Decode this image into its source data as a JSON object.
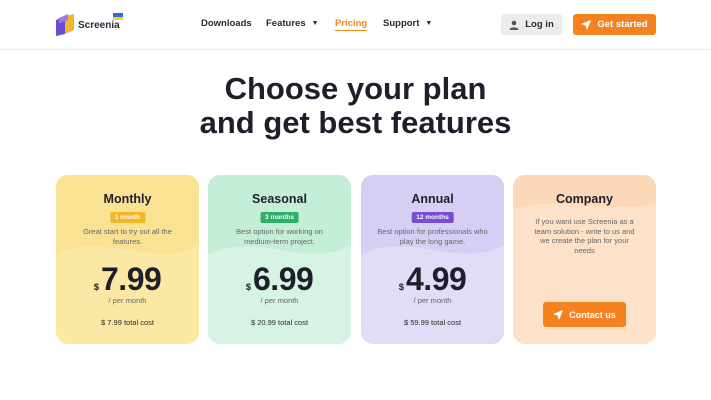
{
  "header": {
    "brand": "Screenia",
    "nav": [
      {
        "label": "Downloads",
        "dropdown": false
      },
      {
        "label": "Features",
        "dropdown": true
      },
      {
        "label": "Pricing",
        "dropdown": false,
        "active": true
      },
      {
        "label": "Support",
        "dropdown": true
      }
    ],
    "login_label": "Log in",
    "start_label": "Get started"
  },
  "heading": {
    "line1": "Choose your plan",
    "line2": "and get best features"
  },
  "plans": [
    {
      "title": "Monthly",
      "badge": "1 month",
      "badge_color": "#f2b62a",
      "description": "Great start to try out all the features.",
      "currency": "$",
      "price": "7.99",
      "period": "/ per month",
      "total": "$ 7.99 total cost",
      "bg": "#fbe8a5"
    },
    {
      "title": "Seasonal",
      "badge": "3 months",
      "badge_color": "#2fae68",
      "description": "Best option for working on medium-term project.",
      "currency": "$",
      "price": "6.99",
      "period": "/ per month",
      "total": "$ 20.99 total cost",
      "bg": "#d6f3e4"
    },
    {
      "title": "Annual",
      "badge": "12 months",
      "badge_color": "#7b4bd1",
      "description": "Best option for professionals who play the long game.",
      "currency": "$",
      "price": "4.99",
      "period": "/ per month",
      "total": "$ 59.99 total cost",
      "bg": "#e2dcf6"
    }
  ],
  "company": {
    "title": "Company",
    "description": "If you want use Screenia as a team solution - write to us and we create the plan for your needs",
    "contact_label": "Contact us",
    "bg": "#fde1c9"
  },
  "colors": {
    "accent": "#f5821f",
    "active_nav": "#f08a1c"
  },
  "icons": {
    "logo": "screenia-logo-icon",
    "flag": "ukraine-flag-icon",
    "login": "user-icon",
    "start": "paper-plane-icon",
    "contact": "paper-plane-icon",
    "caret": "caret-down-icon"
  }
}
